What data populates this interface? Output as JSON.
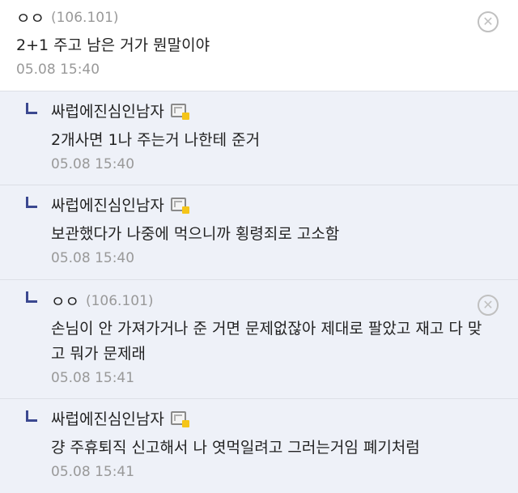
{
  "comments": [
    {
      "nick": "ㅇㅇ",
      "ip": "(106.101)",
      "text": "2+1 주고 남은 거가 뭔말이야",
      "date": "05.08 15:40",
      "delete_icon": "close-circle-icon"
    },
    {
      "nick": "싸럽에진심인남자",
      "text": "2개사면 1나 주는거 나한테 준거",
      "date": "05.08 15:40",
      "badge_icon": "fixed-nick-icon"
    },
    {
      "nick": "싸럽에진심인남자",
      "text": "보관했다가 나중에 먹으니까 횡령죄로 고소함",
      "date": "05.08 15:40",
      "badge_icon": "fixed-nick-icon"
    },
    {
      "nick": "ㅇㅇ",
      "ip": "(106.101)",
      "text_line1": "손님이 안 가져가거나 준 거면 문제없잖아 제대로 팔았고 재고 다 맞",
      "text_line2": "고 뭐가 문제래",
      "date": "05.08 15:41",
      "delete_icon": "close-circle-icon"
    },
    {
      "nick": "싸럽에진심인남자",
      "text": "걍 주휴퇴직 신고해서 나 엿먹일려고 그러는거임 폐기처럼",
      "date": "05.08 15:41",
      "badge_icon": "fixed-nick-icon"
    }
  ],
  "delete_glyph": "✕",
  "colors": {
    "reply_bg": "#eef1f8",
    "reply_mark": "#3b4890",
    "meta_text": "#999999"
  }
}
